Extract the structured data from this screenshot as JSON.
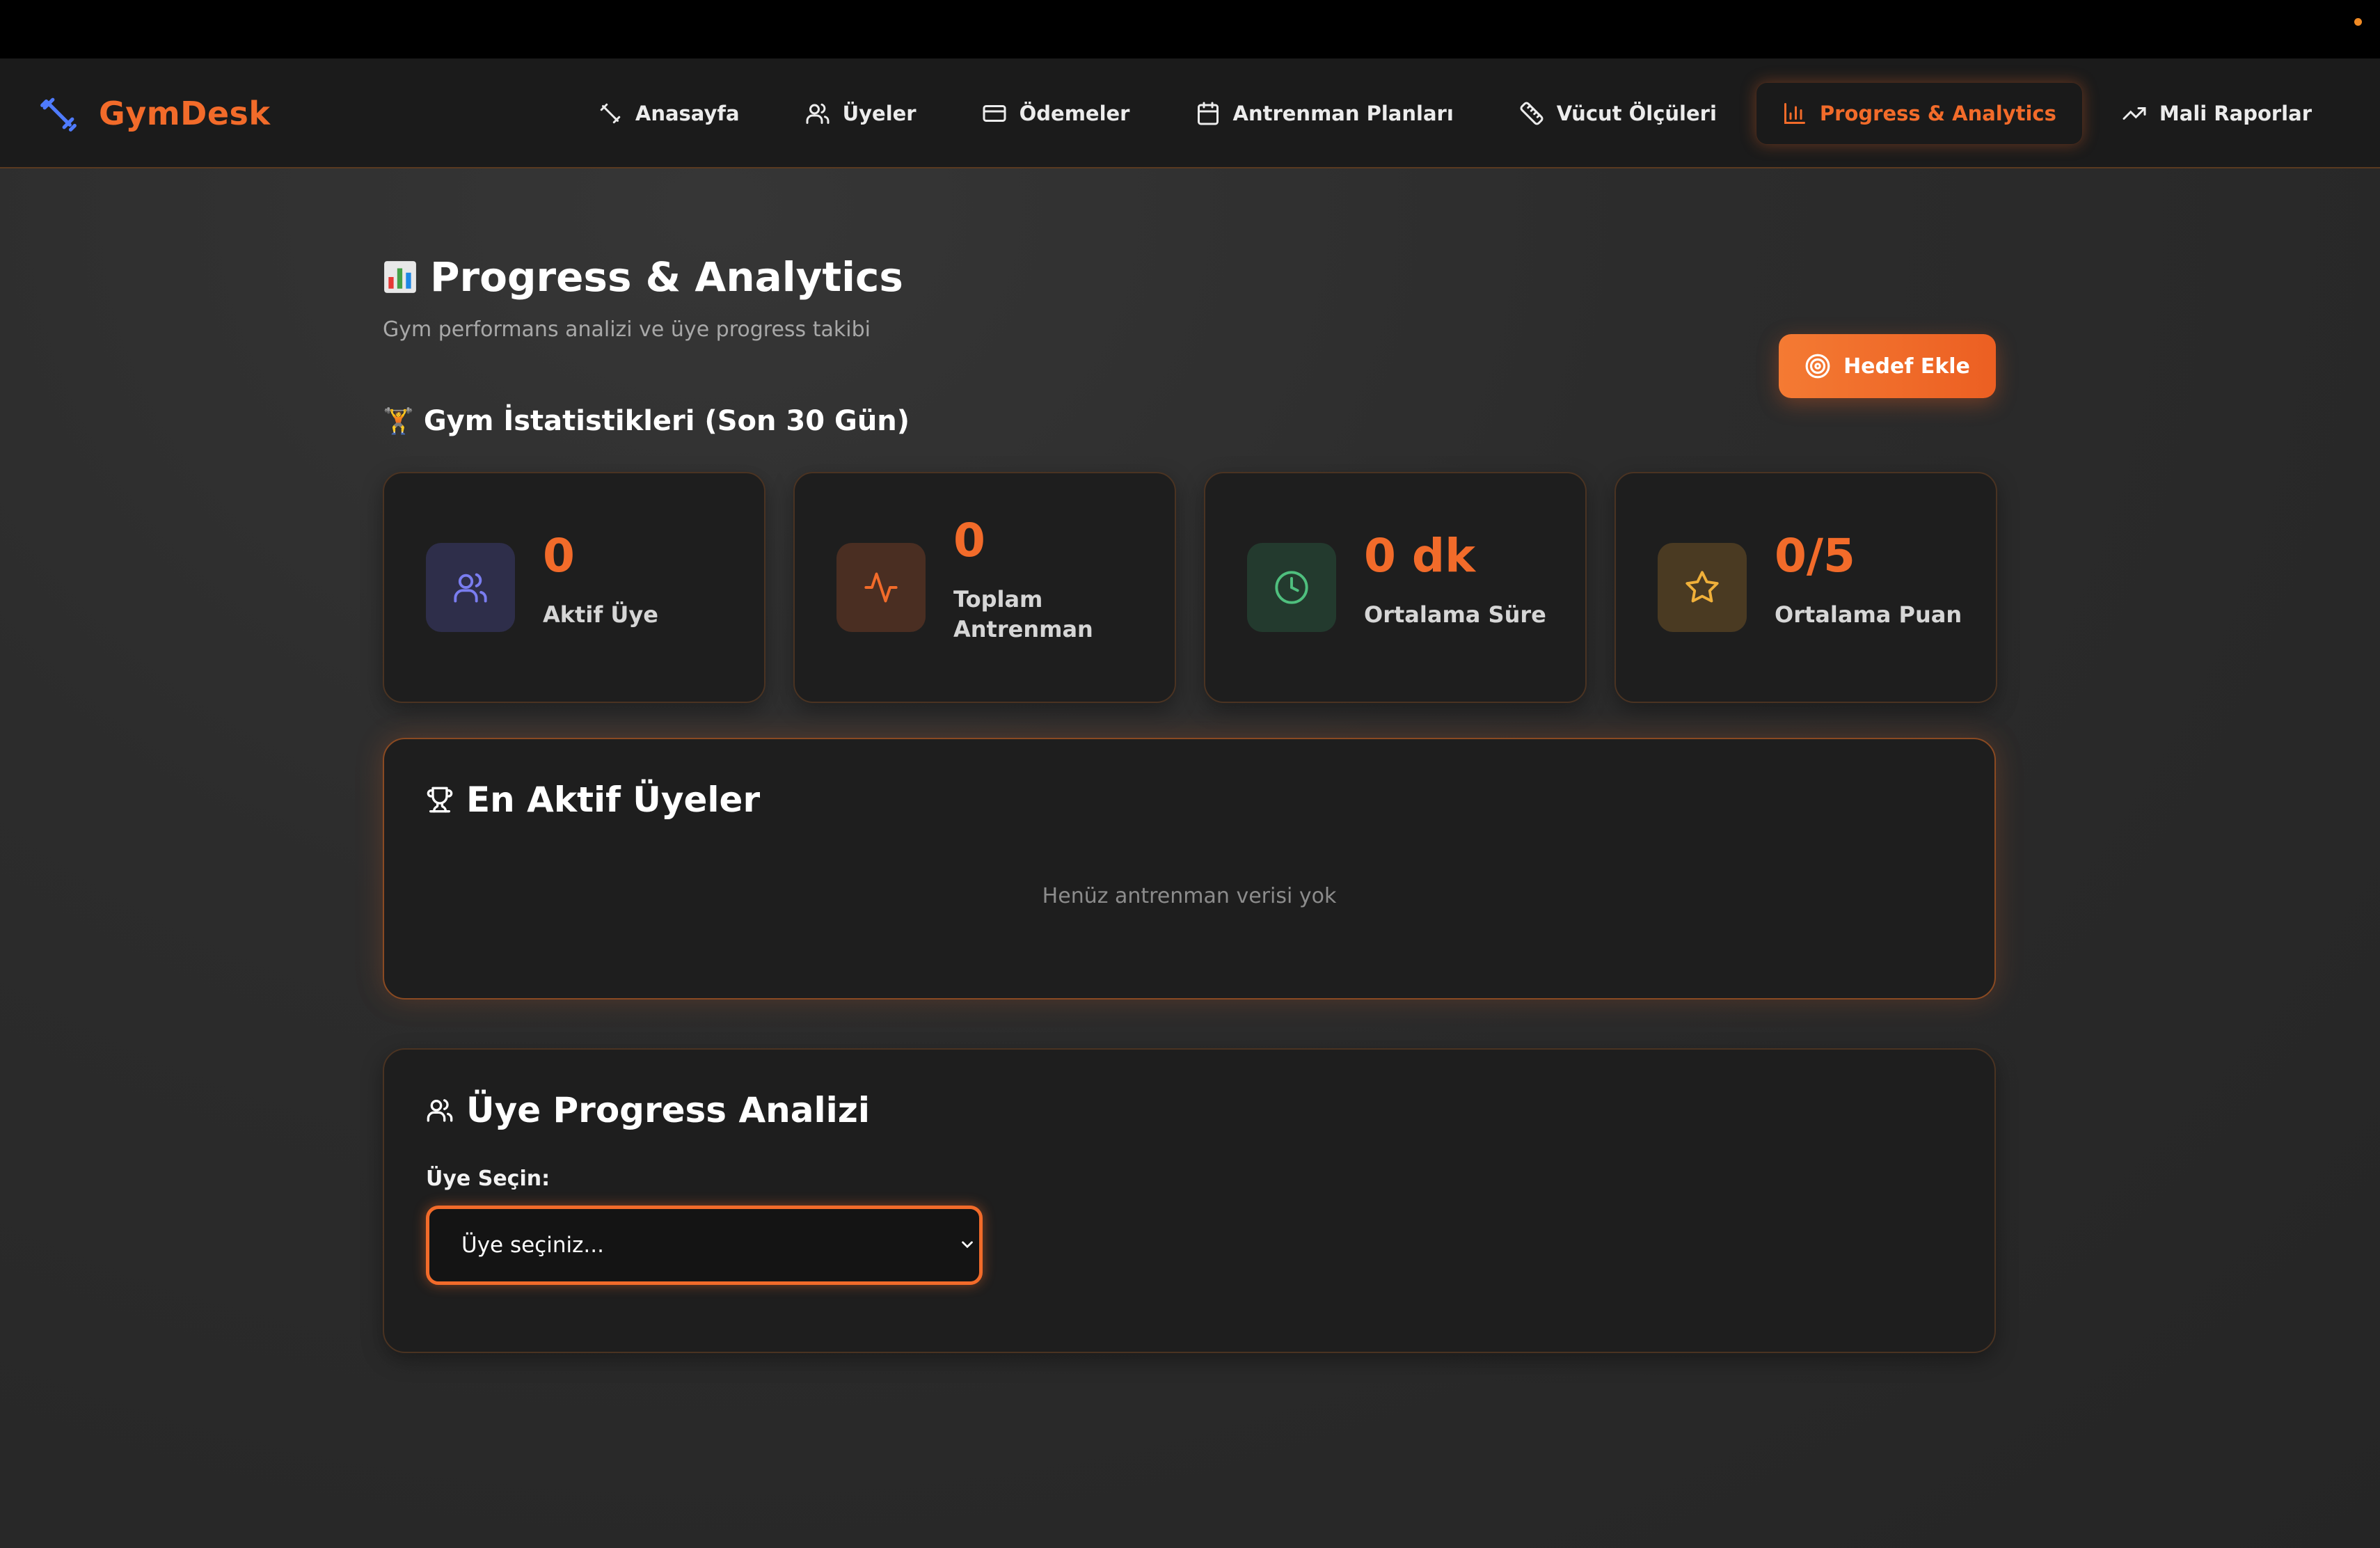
{
  "brand": {
    "name": "GymDesk",
    "icon": "dumbbell-icon",
    "icon_color": "#4f7bff"
  },
  "nav": {
    "items": [
      {
        "label": "Anasayfa",
        "icon": "dumbbell-icon"
      },
      {
        "label": "Üyeler",
        "icon": "users-icon"
      },
      {
        "label": "Ödemeler",
        "icon": "credit-card-icon"
      },
      {
        "label": "Antrenman Planları",
        "icon": "calendar-icon"
      },
      {
        "label": "Vücut Ölçüleri",
        "icon": "ruler-icon"
      },
      {
        "label": "Progress & Analytics",
        "icon": "bar-chart-icon",
        "active": true
      },
      {
        "label": "Mali Raporlar",
        "icon": "trending-up-icon"
      }
    ]
  },
  "header": {
    "title": "Progress & Analytics",
    "title_icon": "chart-emoji-icon",
    "subtitle": "Gym performans analizi ve üye progress takibi",
    "add_goal_label": "Hedef Ekle",
    "add_goal_icon": "target-icon"
  },
  "stats": {
    "title": "Gym İstatistikleri (Son 30 Gün)",
    "title_icon": "weightlifter-emoji-icon",
    "cards": [
      {
        "value": "0",
        "label": "Aktif Üye",
        "icon": "users-icon",
        "icon_bg": "#2e2e4a",
        "icon_color": "#7a7df0"
      },
      {
        "value": "0",
        "label": "Toplam Antrenman",
        "icon": "activity-icon",
        "icon_bg": "#4a2e22",
        "icon_color": "#f26b2a"
      },
      {
        "value": "0 dk",
        "label": "Ortalama Süre",
        "icon": "clock-icon",
        "icon_bg": "#233a2e",
        "icon_color": "#4fbf7e"
      },
      {
        "value": "0/5",
        "label": "Ortalama Puan",
        "icon": "star-icon",
        "icon_bg": "#4a3a22",
        "icon_color": "#f0b03a"
      }
    ]
  },
  "top_members": {
    "title": "En Aktif Üyeler",
    "icon": "trophy-icon",
    "empty_text": "Henüz antrenman verisi yok"
  },
  "member_progress": {
    "title": "Üye Progress Analizi",
    "icon": "users-icon",
    "select_label": "Üye Seçin:",
    "select_value": "Üye seçiniz..."
  },
  "colors": {
    "accent": "#f26b2a",
    "background": "#2a2a2a",
    "card": "#1e1e1e"
  }
}
